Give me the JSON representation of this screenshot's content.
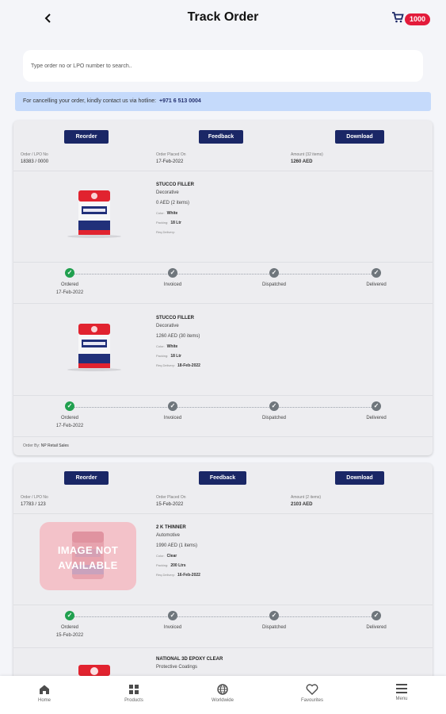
{
  "header": {
    "title": "Track Order",
    "cart_count": "1000"
  },
  "search": {
    "placeholder": "Type order no or LPO number to search.."
  },
  "notice": {
    "text": "For cancelling your order, kindly contact us via hotline:",
    "hotline": "+971 6 513 0004"
  },
  "orders": [
    {
      "buttons": {
        "reorder": "Reorder",
        "feedback": "Feedback",
        "download": "Download"
      },
      "order_no_label": "Order / LPO No",
      "order_no": "18383 / 0000",
      "placed_label": "Order Placed On",
      "placed": "17-Feb-2022",
      "amount_label": "Amount (32 items)",
      "amount": "1260 AED",
      "items": [
        {
          "name": "STUCCO FILLER",
          "category": "Decorative",
          "amount": "0 AED (2 items)",
          "color_label": "Color:",
          "color": "White",
          "packing_label": "Packing:",
          "packing": "18 Ltr",
          "req_label": "Req.Delivery:",
          "req": "",
          "track": [
            {
              "label": "Ordered",
              "date": "17-Feb-2022",
              "status": "done"
            },
            {
              "label": "Invoiced",
              "date": "",
              "status": "pending"
            },
            {
              "label": "Dispatched",
              "date": "",
              "status": "pending"
            },
            {
              "label": "Delivered",
              "date": "",
              "status": "pending"
            }
          ]
        },
        {
          "name": "STUCCO FILLER",
          "category": "Decorative",
          "amount": "1260 AED (30 items)",
          "color_label": "Color:",
          "color": "White",
          "packing_label": "Packing:",
          "packing": "18 Ltr",
          "req_label": "Req.Delivery:",
          "req": "18-Feb-2022",
          "track": [
            {
              "label": "Ordered",
              "date": "17-Feb-2022",
              "status": "done"
            },
            {
              "label": "Invoiced",
              "date": "",
              "status": "pending"
            },
            {
              "label": "Dispatched",
              "date": "",
              "status": "pending"
            },
            {
              "label": "Delivered",
              "date": "",
              "status": "pending"
            }
          ]
        }
      ],
      "order_by_label": "Order By:",
      "order_by": "NP Retail Sales"
    },
    {
      "buttons": {
        "reorder": "Reorder",
        "feedback": "Feedback",
        "download": "Download"
      },
      "order_no_label": "Order / LPO No",
      "order_no": "17783 / 123",
      "placed_label": "Order Placed On",
      "placed": "15-Feb-2022",
      "amount_label": "Amount (2 items)",
      "amount": "2103 AED",
      "items": [
        {
          "name": "2 K THINNER",
          "category": "Automotive",
          "amount": "1990 AED (1 items)",
          "color_label": "Color:",
          "color": "Clear",
          "packing_label": "Packing:",
          "packing": "200 Ltrs",
          "req_label": "Req.Delivery:",
          "req": "16-Feb-2022",
          "image_text": "IMAGE NOT AVAILABLE",
          "track": [
            {
              "label": "Ordered",
              "date": "15-Feb-2022",
              "status": "done"
            },
            {
              "label": "Invoiced",
              "date": "",
              "status": "pending"
            },
            {
              "label": "Dispatched",
              "date": "",
              "status": "pending"
            },
            {
              "label": "Delivered",
              "date": "",
              "status": "pending"
            }
          ]
        },
        {
          "name": "NATIONAL 3D EPOXY CLEAR",
          "category": "Protective Coatings"
        }
      ]
    }
  ],
  "bottom_nav": [
    {
      "label": "Home",
      "icon": "home-icon"
    },
    {
      "label": "Products",
      "icon": "grid-icon"
    },
    {
      "label": "Worldwide",
      "icon": "globe-icon"
    },
    {
      "label": "Favourites",
      "icon": "heart-icon"
    },
    {
      "label": "Menu",
      "icon": "menu-icon"
    }
  ],
  "colors": {
    "primary": "#1a2766",
    "success": "#21a04f",
    "pending": "#6f767c",
    "badge": "#e31b3b",
    "notice_bg": "#c5dafb"
  }
}
